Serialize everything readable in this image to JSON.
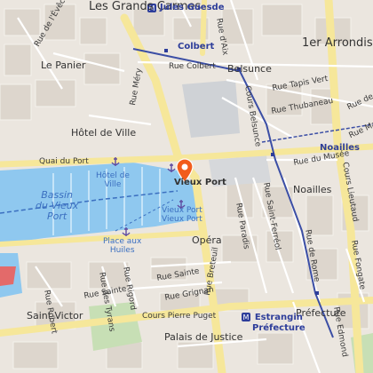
{
  "map": {
    "areas": {
      "grands_carmes": "Les Grands Carmes",
      "le_panier": "Le Panier",
      "hotel_de_ville": "Hôtel de Ville",
      "belsunce": "Belsunce",
      "arrondissement": "1er Arrondis",
      "noailles": "Noailles",
      "opera": "Opéra",
      "prefecture": "Préfecture",
      "saint_victor": "Saint-Victor",
      "palais_de_justice": "Palais de Justice"
    },
    "metro": {
      "jules_guesde": "Jules Guesde",
      "colbert": "Colbert",
      "noailles": "Noailles",
      "estrangin": "Estrangin\nPréfecture"
    },
    "water": {
      "bassin": "Bassin\ndu Vieux\nPort",
      "place_aux_huiles": "Place aux\nHuiles",
      "hotel_de_ville_stop": "Hôtel de\nVille",
      "vieux_port_stop": "Vieux Port\nVieux Port"
    },
    "streets": {
      "rue_colbert": "Rue Colbert",
      "rue_tapis_vert": "Rue Tapis Vert",
      "rue_thubaneau": "Rue Thubaneau",
      "cours_belsunce": "Cours Belsunce",
      "rue_de_lanc": "Rue de l'Anc",
      "rue_dix": "Rue d'Aix",
      "rue_mazagran": "Rue Mazag",
      "rue_du_musee": "Rue du Musée",
      "quai_du_port": "Quai du Port",
      "rue_mery": "Rue Méry",
      "rue_saint_ferreol": "Rue Saint-Ferréol",
      "rue_paradis": "Rue Paradis",
      "rue_de_rome": "Rue de Rome",
      "cours_lieutaud": "Cours Lieutaud",
      "rue_sainte": "Rue Sainte",
      "rue_grignan": "Rue Grignan",
      "rue_breteuil": "Rue Breteuil",
      "cours_pierre_puget": "Cours Pierre Puget",
      "rue_sainte_2": "Rue Sainte",
      "rue_robert": "Rue Robert",
      "rue_des_tyrans": "Rue des Tyrans",
      "rue_rigord": "Rue Rigord",
      "rue_de_la_caisserie": "Rue de l'Évêché",
      "rue_edmond": "Rue Edmond",
      "rue_fongate": "Rue Fongate"
    },
    "marker": {
      "label": "Vieux Port",
      "color": "#f25c1c"
    },
    "colors": {
      "water": "#8fc8ef",
      "major_road": "#f6e79a",
      "metro_line": "#3b4ea5",
      "park": "#c7dfb5"
    }
  }
}
